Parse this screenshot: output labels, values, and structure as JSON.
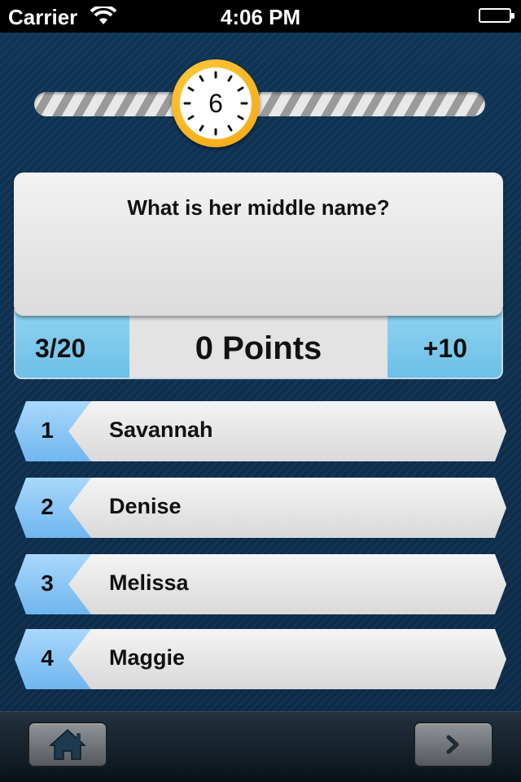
{
  "status_bar": {
    "carrier": "Carrier",
    "time": "4:06 PM"
  },
  "timer": {
    "seconds_remaining": "6"
  },
  "question": {
    "text": "What is her middle name?"
  },
  "score": {
    "progress": "3/20",
    "points": "0 Points",
    "bonus": "+10"
  },
  "answers": [
    {
      "number": "1",
      "label": "Savannah"
    },
    {
      "number": "2",
      "label": "Denise"
    },
    {
      "number": "3",
      "label": "Melissa"
    },
    {
      "number": "4",
      "label": "Maggie"
    }
  ],
  "toolbar": {
    "home_icon": "home-icon",
    "next_icon": "chevron-right-icon"
  },
  "colors": {
    "background": "#0d2d4a",
    "accent_blue": "#7cc6ec",
    "timer_orange": "#f3a10b"
  }
}
